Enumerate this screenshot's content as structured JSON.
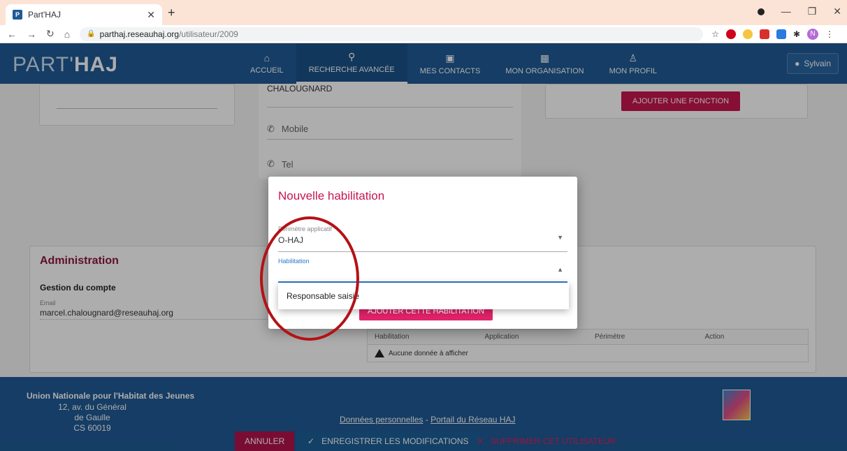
{
  "browser": {
    "tab_title": "Part'HAJ",
    "favicon_letter": "P",
    "url_host": "parthaj.reseauhaj.org",
    "url_path": "/utilisateur/2009",
    "profile_letter": "N"
  },
  "app": {
    "logo_a": "PART'",
    "logo_b": "HAJ",
    "nav": [
      {
        "label": "ACCUEIL",
        "icon": "home-icon"
      },
      {
        "label": "RECHERCHE AVANCÉE",
        "icon": "search-icon"
      },
      {
        "label": "MES CONTACTS",
        "icon": "contact-card-icon"
      },
      {
        "label": "MON ORGANISATION",
        "icon": "building-icon"
      },
      {
        "label": "MON PROFIL",
        "icon": "user-icon"
      }
    ],
    "user_name": "Sylvain"
  },
  "background": {
    "lastname": "CHALOUGNARD",
    "mobile_placeholder": "Mobile",
    "tel_placeholder": "Tel",
    "add_function_label": "AJOUTER UNE FONCTION",
    "admin_title": "Administration",
    "account_title": "Gestion du compte",
    "email_label": "Email",
    "email_value": "marcel.chalougnard@reseauhaj.org",
    "table_headers": [
      "Habilitation",
      "Application",
      "Périmètre",
      "Action"
    ],
    "table_empty": "Aucune donnée à afficher"
  },
  "modal": {
    "title": "Nouvelle habilitation",
    "field_scope_label": "Périmètre applicatif",
    "field_scope_value": "O-HAJ",
    "field_hab_label": "Habilitation",
    "dropdown_option": "Responsable saisie",
    "add_button": "AJOUTER CETTE HABILITATION"
  },
  "footer": {
    "org_name": "Union Nationale pour l'Habitat des Jeunes",
    "address_line1": "12, av. du Général de Gaulle",
    "address_line2": "CS 60019",
    "link_privacy": "Données personnelles",
    "link_separator": " - ",
    "link_portal": "Portail du Réseau HAJ"
  },
  "actions": {
    "cancel": "ANNULER",
    "save": "ENREGISTRER LES MODIFICATIONS",
    "delete": "SUPPRIMER CET UTILISATEUR"
  },
  "colors": {
    "primary": "#1f5b95",
    "accent": "#c7154f",
    "annotation": "#b31217"
  }
}
